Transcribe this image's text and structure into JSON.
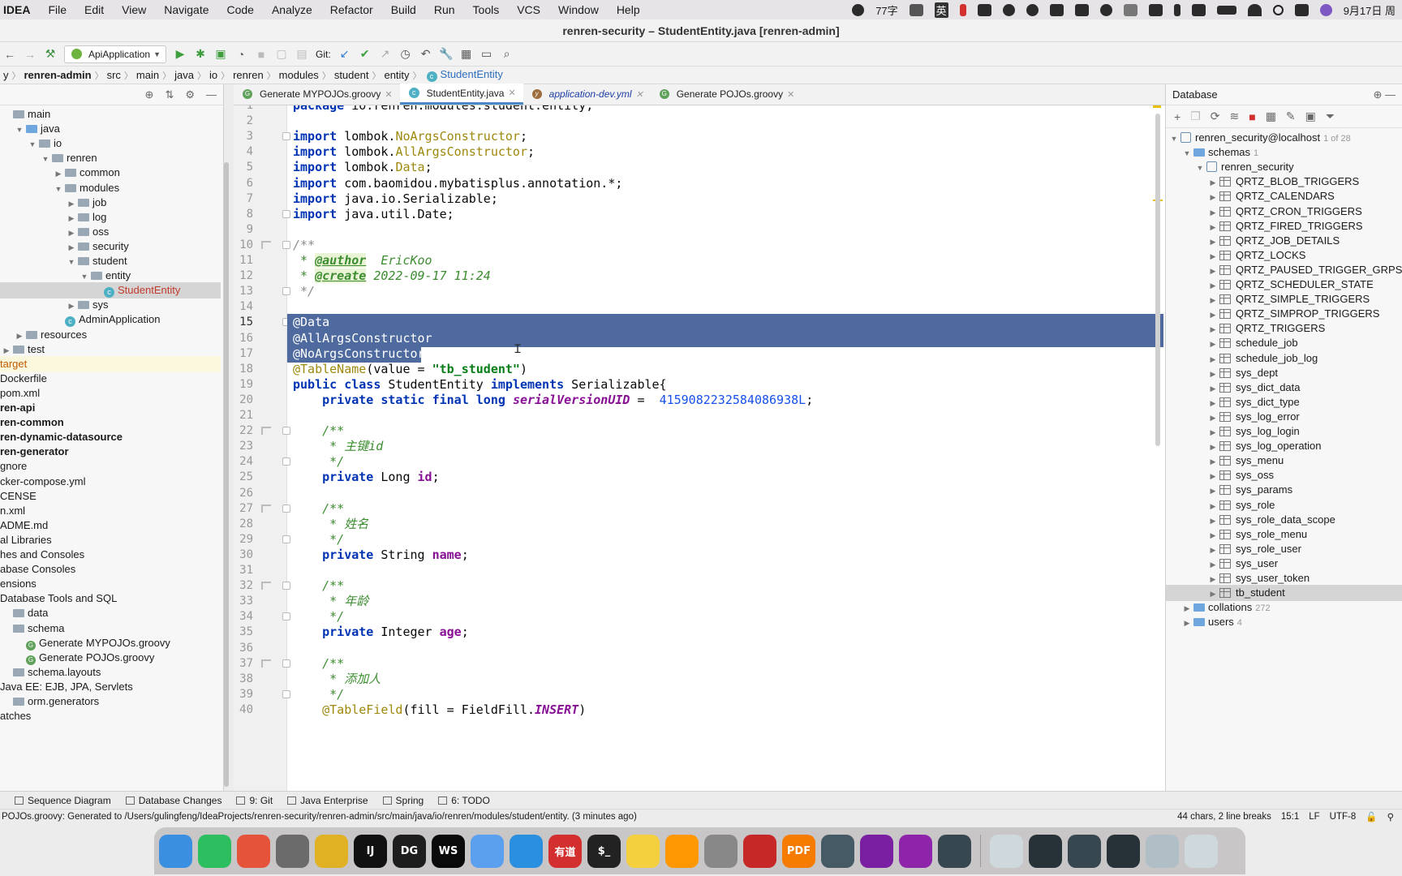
{
  "menubar": {
    "app": "IDEA",
    "items": [
      "File",
      "Edit",
      "View",
      "Navigate",
      "Code",
      "Analyze",
      "Refactor",
      "Build",
      "Run",
      "Tools",
      "VCS",
      "Window",
      "Help"
    ],
    "word_count": "77字",
    "ime": "英",
    "date": "9月17日 周"
  },
  "window_title": "renren-security – StudentEntity.java [renren-admin]",
  "toolbar": {
    "run_config": "ApiApplication",
    "git_label": "Git:"
  },
  "breadcrumb": [
    "y",
    "renren-admin",
    "src",
    "main",
    "java",
    "io",
    "renren",
    "modules",
    "student",
    "entity",
    "StudentEntity"
  ],
  "project_tree": [
    {
      "label": "main",
      "indent": 0,
      "icon": "folder",
      "arrow": ""
    },
    {
      "label": "java",
      "indent": 1,
      "icon": "folder-blue",
      "arrow": "▼"
    },
    {
      "label": "io",
      "indent": 2,
      "icon": "folder",
      "arrow": "▼"
    },
    {
      "label": "renren",
      "indent": 3,
      "icon": "folder",
      "arrow": "▼"
    },
    {
      "label": "common",
      "indent": 4,
      "icon": "folder",
      "arrow": "▶"
    },
    {
      "label": "modules",
      "indent": 4,
      "icon": "folder",
      "arrow": "▼"
    },
    {
      "label": "job",
      "indent": 5,
      "icon": "folder",
      "arrow": "▶"
    },
    {
      "label": "log",
      "indent": 5,
      "icon": "folder",
      "arrow": "▶"
    },
    {
      "label": "oss",
      "indent": 5,
      "icon": "folder",
      "arrow": "▶"
    },
    {
      "label": "security",
      "indent": 5,
      "icon": "folder",
      "arrow": "▶"
    },
    {
      "label": "student",
      "indent": 5,
      "icon": "folder",
      "arrow": "▼"
    },
    {
      "label": "entity",
      "indent": 6,
      "icon": "folder",
      "arrow": "▼"
    },
    {
      "label": "StudentEntity",
      "indent": 7,
      "icon": "class",
      "arrow": "",
      "selected": true
    },
    {
      "label": "sys",
      "indent": 5,
      "icon": "folder",
      "arrow": "▶"
    },
    {
      "label": "AdminApplication",
      "indent": 4,
      "icon": "class",
      "arrow": ""
    },
    {
      "label": "resources",
      "indent": 1,
      "icon": "folder",
      "arrow": "▶"
    },
    {
      "label": "test",
      "indent": 0,
      "icon": "folder",
      "arrow": "▶"
    },
    {
      "label": "target",
      "indent": -1,
      "icon": "",
      "arrow": "",
      "target": true
    },
    {
      "label": "Dockerfile",
      "indent": -1,
      "icon": "",
      "arrow": ""
    },
    {
      "label": "pom.xml",
      "indent": -1,
      "icon": "",
      "arrow": ""
    },
    {
      "label": "ren-api",
      "indent": -1,
      "icon": "",
      "arrow": "",
      "bold": true
    },
    {
      "label": "ren-common",
      "indent": -1,
      "icon": "",
      "arrow": "",
      "bold": true
    },
    {
      "label": "ren-dynamic-datasource",
      "indent": -1,
      "icon": "",
      "arrow": "",
      "bold": true
    },
    {
      "label": "ren-generator",
      "indent": -1,
      "icon": "",
      "arrow": "",
      "bold": true
    },
    {
      "label": "gnore",
      "indent": -1,
      "icon": "",
      "arrow": ""
    },
    {
      "label": "cker-compose.yml",
      "indent": -1,
      "icon": "",
      "arrow": ""
    },
    {
      "label": "CENSE",
      "indent": -1,
      "icon": "",
      "arrow": ""
    },
    {
      "label": "n.xml",
      "indent": -1,
      "icon": "",
      "arrow": ""
    },
    {
      "label": "ADME.md",
      "indent": -1,
      "icon": "",
      "arrow": ""
    },
    {
      "label": "al Libraries",
      "indent": -1,
      "icon": "",
      "arrow": ""
    },
    {
      "label": "hes and Consoles",
      "indent": -1,
      "icon": "",
      "arrow": ""
    },
    {
      "label": "abase Consoles",
      "indent": -1,
      "icon": "",
      "arrow": ""
    },
    {
      "label": "ensions",
      "indent": -1,
      "icon": "",
      "arrow": ""
    },
    {
      "label": "Database Tools and SQL",
      "indent": -1,
      "icon": "",
      "arrow": ""
    },
    {
      "label": "data",
      "indent": 0,
      "icon": "folder",
      "arrow": ""
    },
    {
      "label": "schema",
      "indent": 0,
      "icon": "folder",
      "arrow": ""
    },
    {
      "label": "Generate MYPOJOs.groovy",
      "indent": 1,
      "icon": "groovy",
      "arrow": ""
    },
    {
      "label": "Generate POJOs.groovy",
      "indent": 1,
      "icon": "groovy",
      "arrow": ""
    },
    {
      "label": "schema.layouts",
      "indent": 0,
      "icon": "folder",
      "arrow": ""
    },
    {
      "label": "Java EE: EJB, JPA, Servlets",
      "indent": -1,
      "icon": "",
      "arrow": ""
    },
    {
      "label": "orm.generators",
      "indent": 0,
      "icon": "folder",
      "arrow": ""
    },
    {
      "label": "atches",
      "indent": -1,
      "icon": "",
      "arrow": ""
    }
  ],
  "tabs": [
    {
      "label": "Generate MYPOJOs.groovy",
      "icon": "groovy"
    },
    {
      "label": "StudentEntity.java",
      "icon": "class",
      "active": true
    },
    {
      "label": "application-dev.yml",
      "icon": "yml"
    },
    {
      "label": "Generate POJOs.groovy",
      "icon": "groovy"
    }
  ],
  "code_lines": [
    "<span class=\"kw\">package</span> io.renren.modules.student.entity;",
    "",
    "<span class=\"kw\">import</span> lombok.<span class=\"ann\">NoArgsConstructor</span>;",
    "<span class=\"kw\">import</span> lombok.<span class=\"ann\">AllArgsConstructor</span>;",
    "<span class=\"kw\">import</span> lombok.<span class=\"ann\">Data</span>;",
    "<span class=\"kw\">import</span> com.baomidou.mybatisplus.annotation.*;",
    "<span class=\"kw\">import</span> java.io.Serializable;",
    "<span class=\"kw\">import</span> java.util.Date;",
    "",
    "<span class=\"com\">/**</span>",
    "<span class=\"doc\"> * <span class=\"tag\">@author</span>  EricKoo</span>",
    "<span class=\"doc\"> * <span class=\"tag\">@create</span> 2022-09-17 11:24</span>",
    "<span class=\"com\"> */</span>",
    "",
    "<span class=\"ann-sel\">@Data</span>",
    "<span class=\"ann-sel\">@AllArgsConstructor</span>",
    "<span class=\"ann-sel\">@NoArgsConstructor</span>",
    "<span class=\"ann\">@TableName</span>(value = <span class=\"str\">\"tb_student\"</span>)",
    "<span class=\"kw\">public class</span> StudentEntity <span class=\"kw\">implements</span> Serializable{",
    "    <span class=\"kw\">private static final long</span> <span class=\"ifield\">serialVersionUID</span> =  <span class=\"num\">4159082232584086938L</span>;",
    "",
    "    <span class=\"doc\">/**</span>",
    "    <span class=\"doc\"> * 主键id</span>",
    "    <span class=\"doc\"> */</span>",
    "    <span class=\"kw\">private</span> Long <span class=\"field\">id</span>;",
    "",
    "    <span class=\"doc\">/**</span>",
    "    <span class=\"doc\"> * 姓名</span>",
    "    <span class=\"doc\"> */</span>",
    "    <span class=\"kw\">private</span> String <span class=\"field\">name</span>;",
    "",
    "    <span class=\"doc\">/**</span>",
    "    <span class=\"doc\"> * 年龄</span>",
    "    <span class=\"doc\"> */</span>",
    "    <span class=\"kw\">private</span> Integer <span class=\"field\">age</span>;",
    "",
    "    <span class=\"doc\">/**</span>",
    "    <span class=\"doc\"> * 添加人</span>",
    "    <span class=\"doc\"> */</span>",
    "    <span class=\"ann\">@TableField</span>(fill = FieldFill.<span class=\"ifield\">INSERT</span>)"
  ],
  "selected_lines": [
    15,
    16,
    17
  ],
  "current_line": 15,
  "database": {
    "title": "Database",
    "connection": "renren_security@localhost",
    "connection_count": "1 of 28",
    "schemas_label": "schemas",
    "schemas_count": "1",
    "schema": "renren_security",
    "tables": [
      "QRTZ_BLOB_TRIGGERS",
      "QRTZ_CALENDARS",
      "QRTZ_CRON_TRIGGERS",
      "QRTZ_FIRED_TRIGGERS",
      "QRTZ_JOB_DETAILS",
      "QRTZ_LOCKS",
      "QRTZ_PAUSED_TRIGGER_GRPS",
      "QRTZ_SCHEDULER_STATE",
      "QRTZ_SIMPLE_TRIGGERS",
      "QRTZ_SIMPROP_TRIGGERS",
      "QRTZ_TRIGGERS",
      "schedule_job",
      "schedule_job_log",
      "sys_dept",
      "sys_dict_data",
      "sys_dict_type",
      "sys_log_error",
      "sys_log_login",
      "sys_log_operation",
      "sys_menu",
      "sys_oss",
      "sys_params",
      "sys_role",
      "sys_role_data_scope",
      "sys_role_menu",
      "sys_role_user",
      "sys_user",
      "sys_user_token",
      "tb_student"
    ],
    "selected_table": "tb_student",
    "collations_label": "collations",
    "collations_count": "272",
    "users_label": "users",
    "users_count": "4"
  },
  "toolwindows": [
    {
      "label": "Sequence Diagram"
    },
    {
      "label": "Database Changes"
    },
    {
      "label": "9: Git"
    },
    {
      "label": "Java Enterprise"
    },
    {
      "label": "Spring"
    },
    {
      "label": "6: TODO"
    }
  ],
  "status": {
    "message": "POJOs.groovy: Generated to /Users/gulingfeng/IdeaProjects/renren-security/renren-admin/src/main/java/io/renren/modules/student/entity. (3 minutes ago)",
    "selection": "44 chars, 2 line breaks",
    "position": "15:1",
    "line_sep": "LF",
    "encoding": "UTF-8"
  },
  "dock": [
    {
      "name": "finder",
      "color": "#3b8fe0",
      "glyph": ""
    },
    {
      "name": "evernote",
      "color": "#2dbe60",
      "glyph": ""
    },
    {
      "name": "launchpad",
      "color": "#e5533a",
      "glyph": ""
    },
    {
      "name": "rocket-typist",
      "color": "#6b6b6b",
      "glyph": ""
    },
    {
      "name": "chrome",
      "color": "#e0b223",
      "glyph": ""
    },
    {
      "name": "intellij",
      "color": "#111111",
      "glyph": "IJ"
    },
    {
      "name": "datagrip",
      "color": "#1d1d1d",
      "glyph": "DG"
    },
    {
      "name": "webstorm",
      "color": "#0a0a0a",
      "glyph": "WS"
    },
    {
      "name": "arc",
      "color": "#5aa0ee",
      "glyph": ""
    },
    {
      "name": "vscode",
      "color": "#2b8fe0",
      "glyph": ""
    },
    {
      "name": "youdao",
      "color": "#d32f2f",
      "glyph": "有道"
    },
    {
      "name": "terminal",
      "color": "#222222",
      "glyph": "$_"
    },
    {
      "name": "qq-music",
      "color": "#f4d03f",
      "glyph": ""
    },
    {
      "name": "sublime",
      "color": "#ff9800",
      "glyph": ""
    },
    {
      "name": "system-preferences",
      "color": "#888888",
      "glyph": ""
    },
    {
      "name": "parallels",
      "color": "#c62828",
      "glyph": ""
    },
    {
      "name": "pdf-expert",
      "color": "#f57c00",
      "glyph": "PDF"
    },
    {
      "name": "screenshot",
      "color": "#455a64",
      "glyph": ""
    },
    {
      "name": "centos",
      "color": "#7b1fa2",
      "glyph": ""
    },
    {
      "name": "centos-2",
      "color": "#8e24aa",
      "glyph": ""
    },
    {
      "name": "quicktime",
      "color": "#37474f",
      "glyph": ""
    },
    {
      "name": "documents",
      "color": "#cfd8dc",
      "glyph": ""
    },
    {
      "name": "window-1",
      "color": "#263238",
      "glyph": ""
    },
    {
      "name": "window-2",
      "color": "#37474f",
      "glyph": ""
    },
    {
      "name": "window-3",
      "color": "#263238",
      "glyph": ""
    },
    {
      "name": "keyboard",
      "color": "#b0bec5",
      "glyph": ""
    },
    {
      "name": "trash",
      "color": "#cfd8dc",
      "glyph": ""
    }
  ]
}
